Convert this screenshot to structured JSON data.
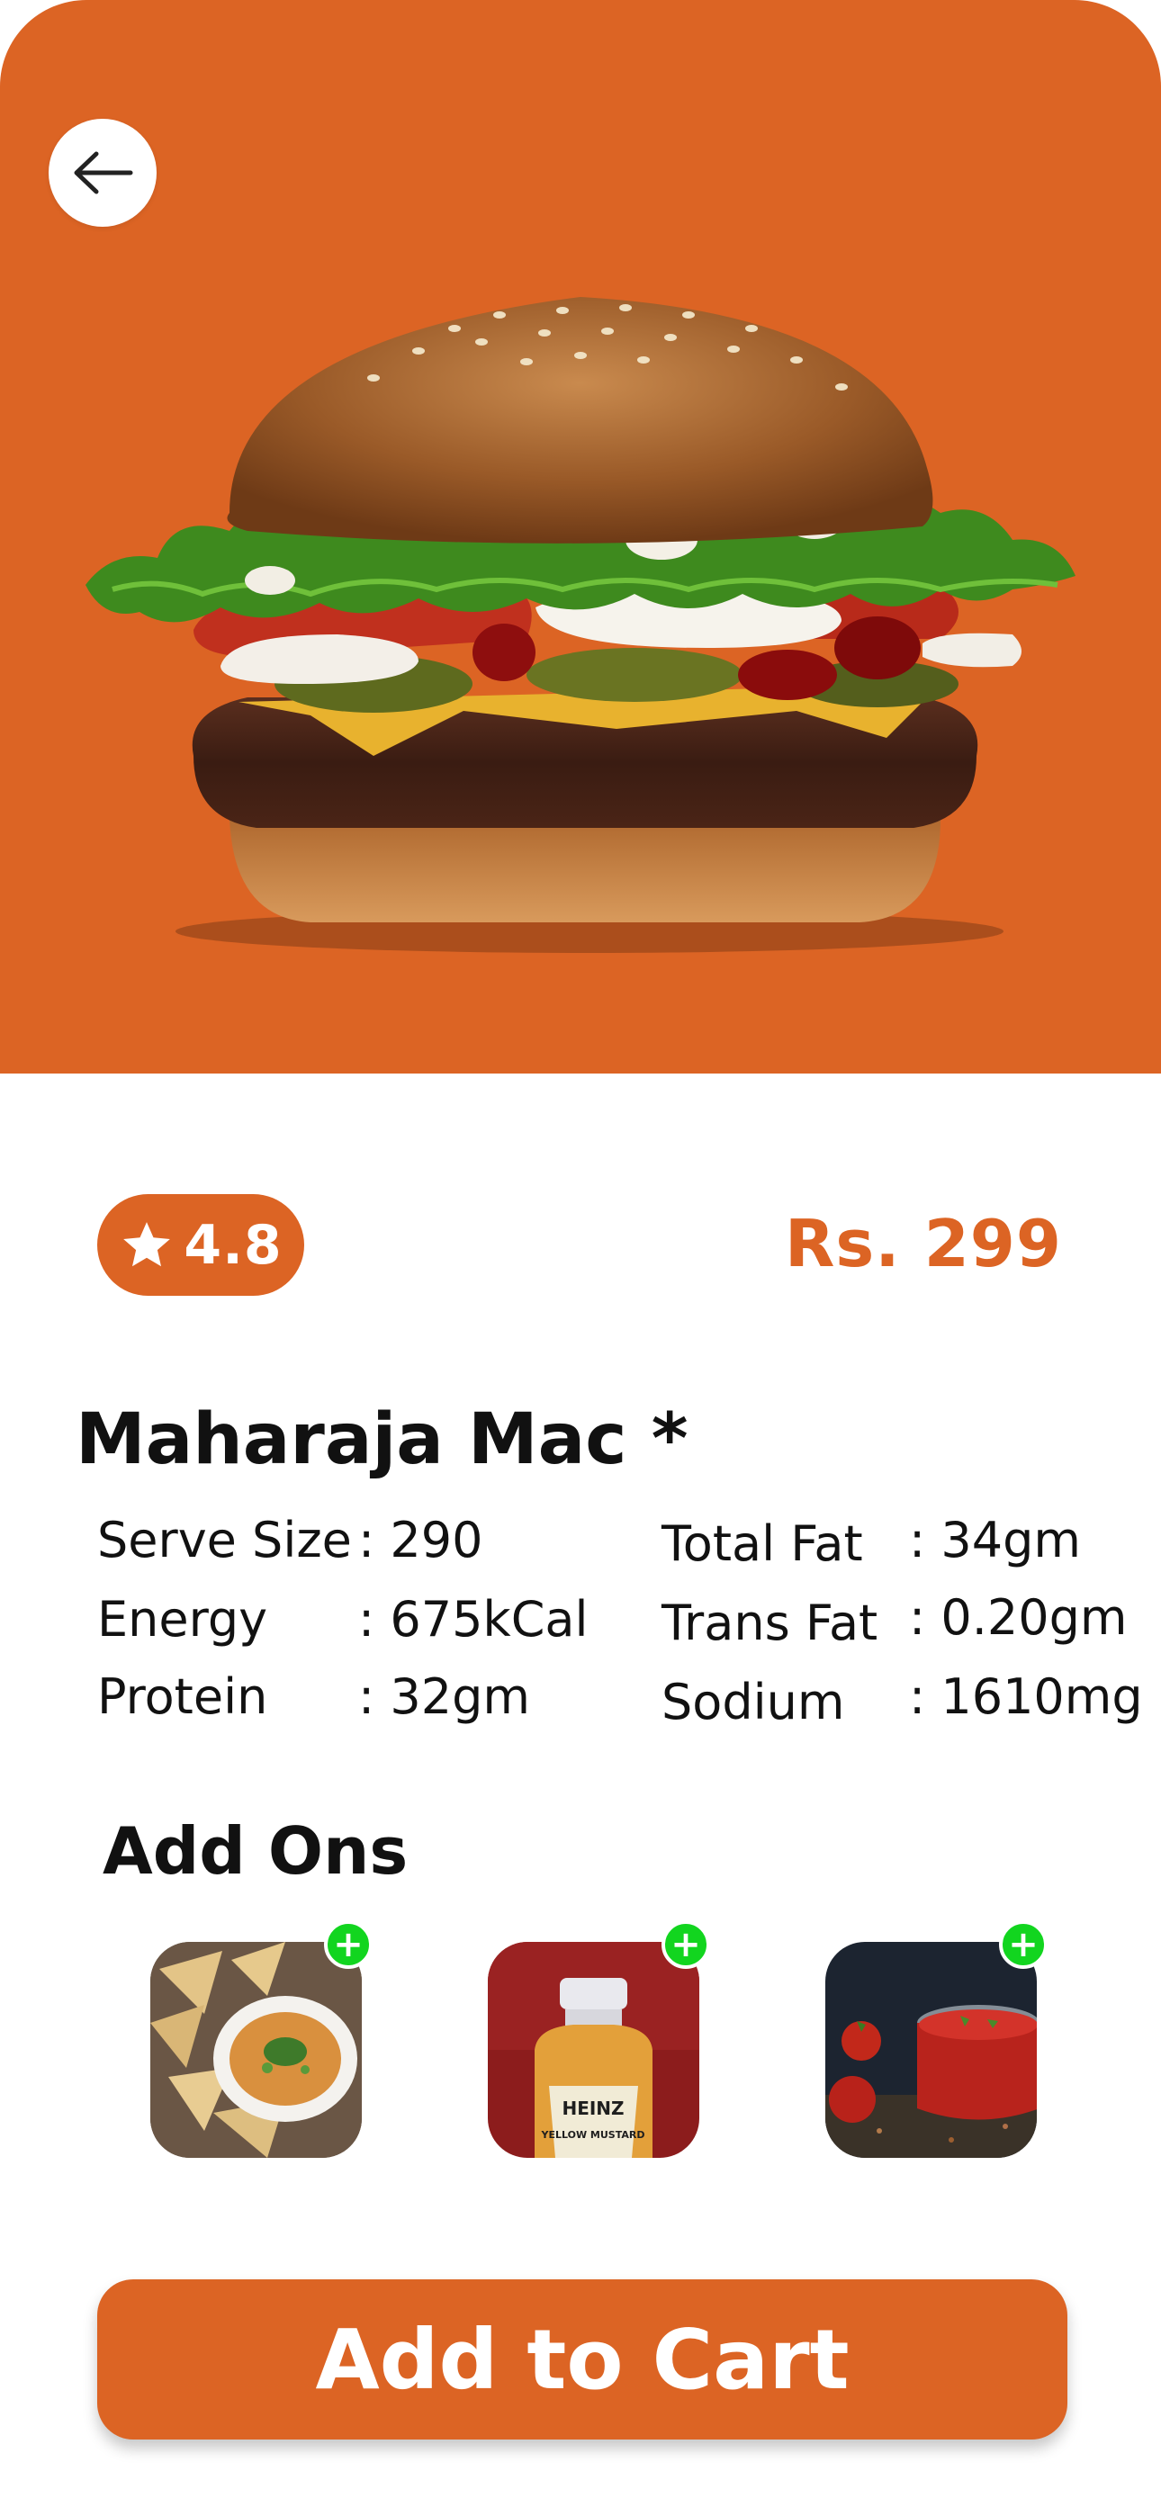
{
  "colors": {
    "accent": "#DC6424",
    "add_badge": "#12D51F",
    "background": "#FFFFFF",
    "text": "#111111"
  },
  "header": {
    "back_icon": "arrow-left-icon"
  },
  "product": {
    "image": "burger-photo",
    "rating": "4.8",
    "rating_icon": "star-icon",
    "price": "Rs. 299",
    "name": "Maharaja Mac *"
  },
  "nutrition": {
    "left": [
      {
        "label": "Serve Size",
        "value": ": 290"
      },
      {
        "label": "Energy",
        "value": ": 675kCal"
      },
      {
        "label": "Protein",
        "value": ": 32gm"
      }
    ],
    "right": [
      {
        "label": "Total Fat",
        "value": ": 34gm"
      },
      {
        "label": "Trans Fat",
        "value": ": 0.20gm"
      },
      {
        "label": "Sodium",
        "value": ": 1610mg"
      }
    ]
  },
  "addons": {
    "title": "Add Ons",
    "items": [
      {
        "image": "nachos-dip-photo",
        "add_icon": "plus-icon"
      },
      {
        "image": "heinz-mustard-photo",
        "brand_text": "HEINZ",
        "product_text": "YELLOW MUSTARD",
        "add_icon": "plus-icon"
      },
      {
        "image": "tomato-sauce-photo",
        "add_icon": "plus-icon"
      }
    ]
  },
  "cart": {
    "button_label": "Add to Cart"
  }
}
